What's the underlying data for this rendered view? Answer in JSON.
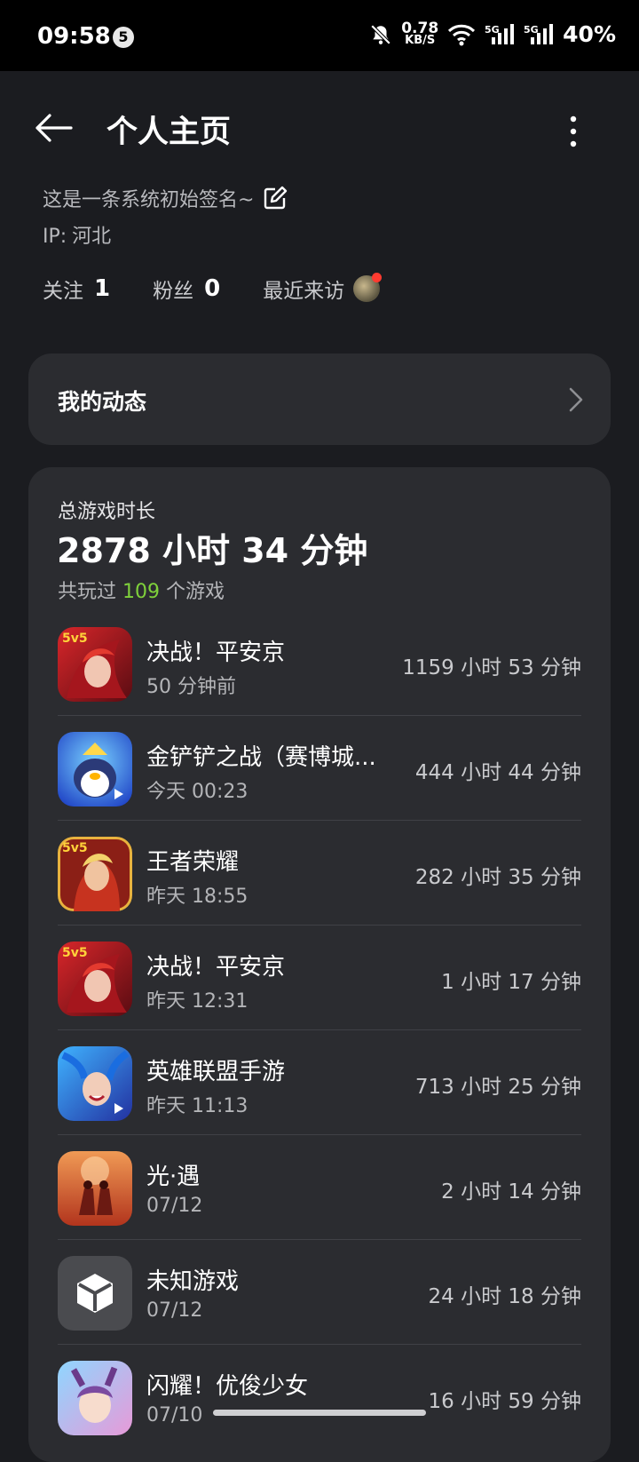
{
  "status_bar": {
    "time": "09:58",
    "badge": "5",
    "speed_value": "0.78",
    "speed_unit": "KB/S",
    "battery": "40%"
  },
  "header": {
    "title": "个人主页",
    "back_icon": "arrow-left-icon",
    "more_icon": "more-vertical-icon"
  },
  "profile": {
    "signature": "这是一条系统初始签名~",
    "ip_label": "IP:",
    "ip_value": "河北",
    "following_label": "关注",
    "following_count": "1",
    "fans_label": "粉丝",
    "fans_count": "0",
    "visitors_label": "最近来访"
  },
  "dynamics": {
    "label": "我的动态"
  },
  "games": {
    "total_label": "总游戏时长",
    "total_value": "2878 小时 34 分钟",
    "played_prefix": "共玩过",
    "played_count": "109",
    "played_suffix": "个游戏",
    "items": [
      {
        "name": "决战！平安京",
        "last_played": "50 分钟前",
        "duration": "1159 小时 53 分钟",
        "icon": "onmyoji-arena-icon"
      },
      {
        "name": "金铲铲之战（赛博城...",
        "last_played": "今天 00:23",
        "duration": "444 小时 44 分钟",
        "icon": "golden-spatula-icon"
      },
      {
        "name": "王者荣耀",
        "last_played": "昨天 18:55",
        "duration": "282 小时 35 分钟",
        "icon": "honor-of-kings-icon"
      },
      {
        "name": "决战！平安京",
        "last_played": "昨天 12:31",
        "duration": "1 小时 17 分钟",
        "icon": "onmyoji-arena-icon"
      },
      {
        "name": "英雄联盟手游",
        "last_played": "昨天 11:13",
        "duration": "713 小时 25 分钟",
        "icon": "league-wild-rift-icon"
      },
      {
        "name": "光·遇",
        "last_played": "07/12",
        "duration": "2 小时 14 分钟",
        "icon": "sky-icon"
      },
      {
        "name": "未知游戏",
        "last_played": "07/12",
        "duration": "24 小时 18 分钟",
        "icon": "unknown-game-icon"
      },
      {
        "name": "闪耀！优俊少女",
        "last_played": "07/10",
        "duration": "16 小时 59 分钟",
        "icon": "umamusume-icon"
      }
    ]
  }
}
